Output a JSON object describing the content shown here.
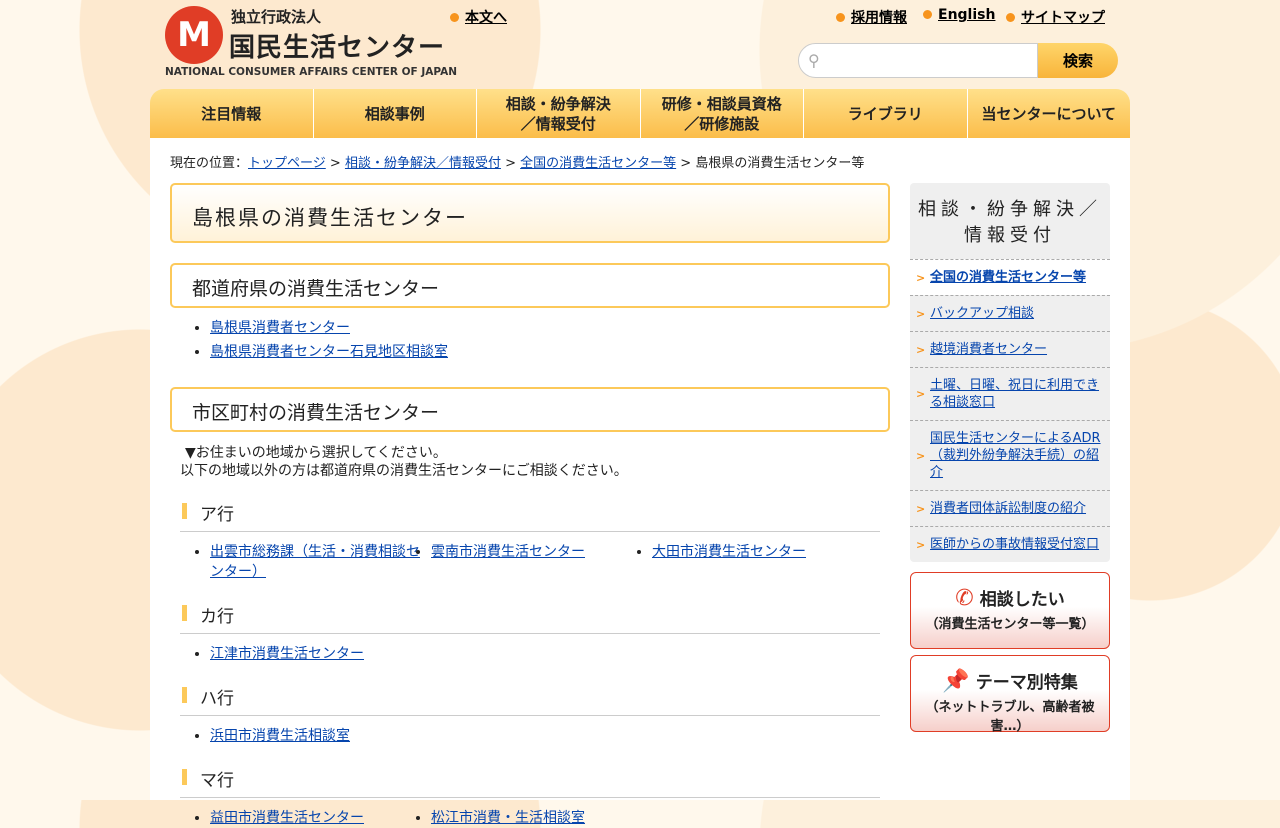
{
  "header": {
    "logo_small": "独立行政法人",
    "logo_main": "国民生活センター",
    "logo_en": "NATIONAL CONSUMER AFFAIRS CENTER OF JAPAN",
    "skip_link": "本文へ",
    "links": [
      "採用情報",
      "English",
      "サイトマップ"
    ],
    "search_placeholder": "",
    "search_button": "検索"
  },
  "nav": [
    "注目情報",
    "相談事例",
    "相談・紛争解決\n／情報受付",
    "研修・相談員資格\n／研修施設",
    "ライブラリ",
    "当センターについて"
  ],
  "breadcrumb": {
    "prefix": "現在の位置：",
    "items": [
      "トップページ",
      "相談・紛争解決／情報受付",
      "全国の消費生活センター等"
    ],
    "sep": " > ",
    "current": "島根県の消費生活センター等"
  },
  "page_title": "島根県の消費生活センター",
  "prefecture": {
    "heading": "都道府県の消費生活センター",
    "links": [
      "島根県消費者センター",
      "島根県消費者センター石見地区相談室"
    ]
  },
  "municipal": {
    "heading": "市区町村の消費生活センター",
    "intro1": "▼お住まいの地域から選択してください。",
    "intro2": "以下の地域以外の方は都道府県の消費生活センターにご相談ください。",
    "groups": [
      {
        "title": "ア行",
        "links": [
          "出雲市総務課（生活・消費相談センター）",
          "雲南市消費生活センター",
          "大田市消費生活センター"
        ]
      },
      {
        "title": "カ行",
        "links": [
          "江津市消費生活センター"
        ]
      },
      {
        "title": "ハ行",
        "links": [
          "浜田市消費生活相談室"
        ]
      },
      {
        "title": "マ行",
        "links": [
          "益田市消費生活センター",
          "松江市消費・生活相談室"
        ]
      }
    ]
  },
  "sidebar": {
    "title": "相談・紛争解決／情報受付",
    "items": [
      "全国の消費生活センター等",
      "バックアップ相談",
      "越境消費者センター",
      "土曜、日曜、祝日に利用できる相談窓口",
      "国民生活センターによるADR（裁判外紛争解決手続）の紹介",
      "消費者団体訴訟制度の紹介",
      "医師からの事故情報受付窓口"
    ]
  },
  "banners": [
    {
      "title": "相談したい",
      "sub": "（消費生活センター等一覧）",
      "icon": "phone-icon"
    },
    {
      "title": "テーマ別特集",
      "sub": "（ネットトラブル、高齢者被害…）",
      "icon": "pushpin-icon"
    }
  ]
}
